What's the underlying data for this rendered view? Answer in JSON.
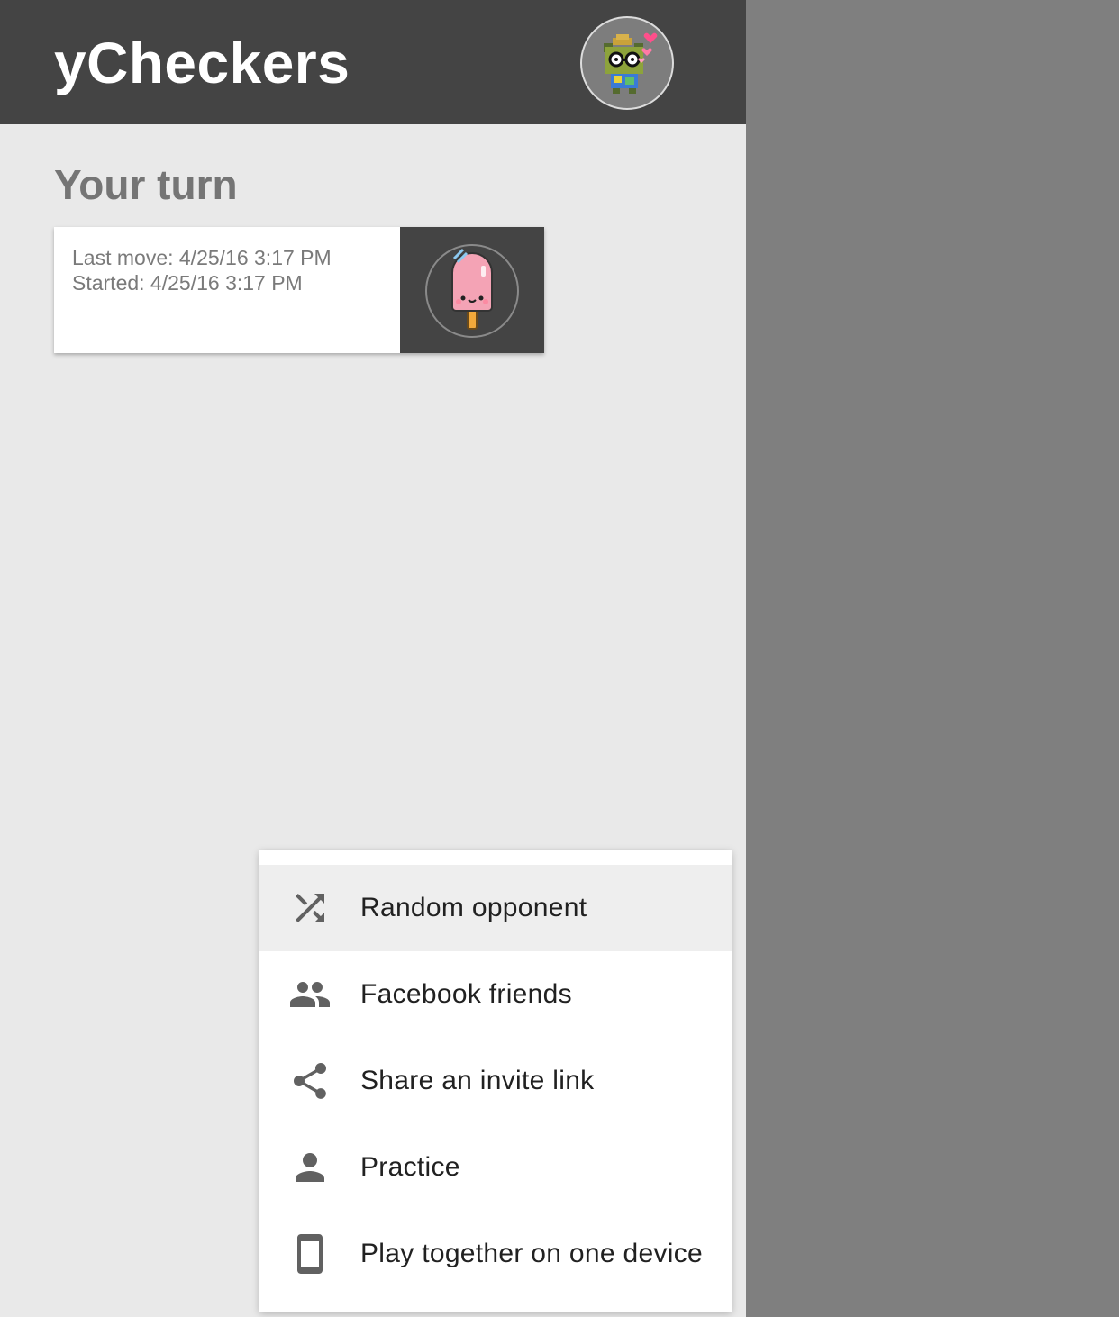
{
  "header": {
    "title": "yCheckers",
    "avatar_icon": "player-avatar-pixel-creature"
  },
  "your_turn": {
    "heading": "Your turn",
    "games": [
      {
        "last_move": "Last move: 4/25/16 3:17 PM",
        "started": "Started: 4/25/16 3:17 PM",
        "opponent_icon": "popsicle-avatar"
      }
    ]
  },
  "new_game_menu": {
    "items": [
      {
        "label": "Random opponent",
        "icon": "shuffle-icon",
        "highlighted": true
      },
      {
        "label": "Facebook friends",
        "icon": "people-icon",
        "highlighted": false
      },
      {
        "label": "Share an invite link",
        "icon": "share-icon",
        "highlighted": false
      },
      {
        "label": "Practice",
        "icon": "person-icon",
        "highlighted": false
      },
      {
        "label": "Play together on one device",
        "icon": "phone-icon",
        "highlighted": false
      }
    ]
  },
  "colors": {
    "header_bg": "#444444",
    "page_bg": "#e9e9e9",
    "side_bg": "#7f7f7f",
    "popsicle_pink": "#f4a3b5"
  }
}
